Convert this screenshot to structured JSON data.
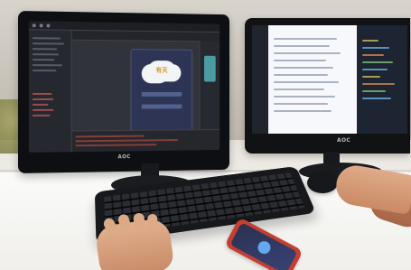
{
  "monitor_main": {
    "brand": "AOC",
    "preview_title": "有天"
  },
  "monitor_second": {
    "brand": "AOC"
  }
}
